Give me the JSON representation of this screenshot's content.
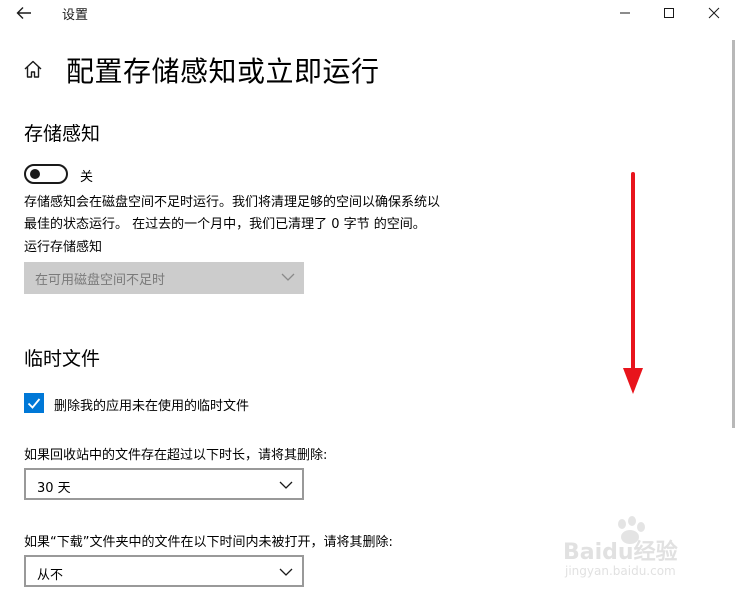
{
  "window": {
    "title": "设置",
    "minimize_icon": "minimize-icon",
    "maximize_icon": "maximize-icon",
    "close_icon": "close-icon"
  },
  "header": {
    "back_icon": "back-arrow-icon",
    "home_icon": "home-icon",
    "page_title": "配置存储感知或立即运行"
  },
  "storage_sense": {
    "section_title": "存储感知",
    "toggle_state": "关",
    "toggle_on": false,
    "description_lines": [
      "存储感知会在磁盘空间不足时运行。我们将清理足够的空间以确保系统以",
      "最佳的状态运行。 在过去的一个月中，我们已清理了 0 字节 的空间。"
    ],
    "run_label": "运行存储感知",
    "run_dropdown_value": "在可用磁盘空间不足时",
    "run_dropdown_disabled": true
  },
  "temp_files": {
    "section_title": "临时文件",
    "delete_temp_checkbox_label": "删除我的应用未在使用的临时文件",
    "delete_temp_checked": true,
    "recycle_bin_label": "如果回收站中的文件存在超过以下时长，请将其删除:",
    "recycle_bin_value": "30 天",
    "downloads_label": "如果“下载”文件夹中的文件在以下时间内未被打开，请将其删除:",
    "downloads_value": "从不"
  },
  "annotation": {
    "arrow_color": "#e8141c",
    "direction": "down"
  },
  "watermark": {
    "brand": "Baidu经验",
    "url": "jingyan.baidu.com"
  },
  "colors": {
    "accent": "#0078d7",
    "disabled_bg": "#cccccc"
  }
}
